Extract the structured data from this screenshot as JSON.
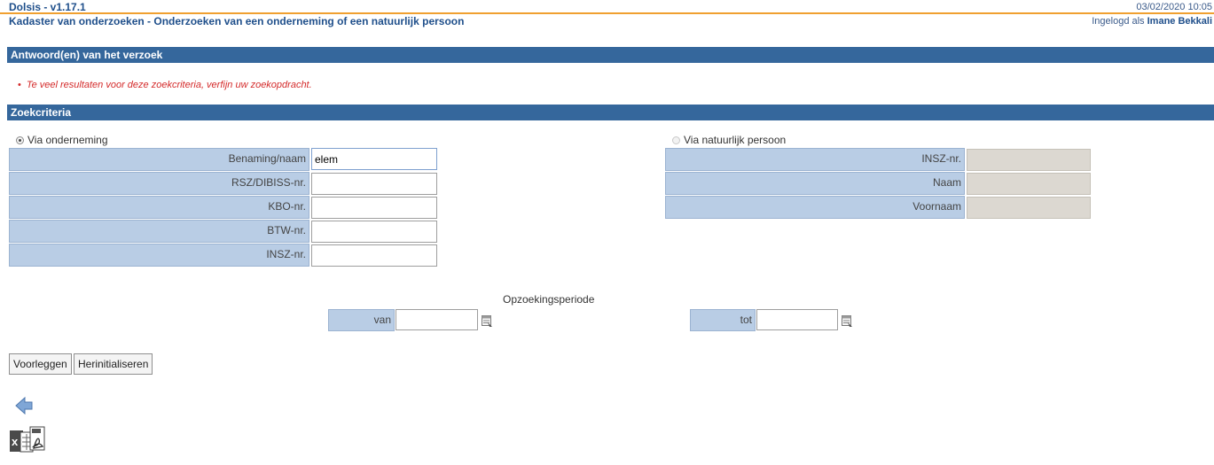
{
  "header": {
    "app_title": "Dolsis - v1.17.1",
    "datetime": "03/02/2020 10:05",
    "page_title": "Kadaster van onderzoeken - Onderzoeken van een onderneming of een natuurlijk persoon",
    "login_prefix": "Ingelogd als",
    "user_name": "Imane Bekkali"
  },
  "answers": {
    "title": "Antwoord(en) van het verzoek",
    "error": "Te veel resultaten voor deze zoekcriteria, verfijn uw zoekopdracht."
  },
  "criteria": {
    "title": "Zoekcriteria",
    "company": {
      "radio_label": "Via onderneming",
      "selected": true,
      "fields": [
        {
          "label": "Benaming/naam",
          "value": "elem"
        },
        {
          "label": "RSZ/DIBISS-nr.",
          "value": ""
        },
        {
          "label": "KBO-nr.",
          "value": ""
        },
        {
          "label": "BTW-nr.",
          "value": ""
        },
        {
          "label": "INSZ-nr.",
          "value": ""
        }
      ]
    },
    "person": {
      "radio_label": "Via natuurlijk persoon",
      "selected": false,
      "fields": [
        {
          "label": "INSZ-nr.",
          "value": ""
        },
        {
          "label": "Naam",
          "value": ""
        },
        {
          "label": "Voornaam",
          "value": ""
        }
      ]
    },
    "period": {
      "title": "Opzoekingsperiode",
      "from_label": "van",
      "from_value": "",
      "to_label": "tot",
      "to_value": ""
    }
  },
  "actions": {
    "submit": "Voorleggen",
    "reset": "Herinitialiseren"
  },
  "icons": {
    "back": "back-arrow-icon",
    "export": "excel-pdf-export-icon",
    "calendar": "calendar-icon"
  },
  "colors": {
    "section_bar": "#35679c",
    "label_bg": "#b9cde5",
    "error": "#d42b2b",
    "accent_line": "#f0a030",
    "title_text": "#1f4f8b"
  }
}
